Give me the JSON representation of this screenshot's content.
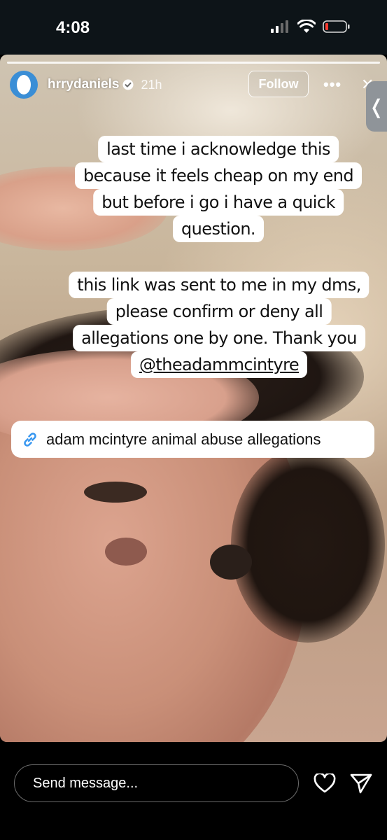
{
  "status_bar": {
    "time": "4:08"
  },
  "story": {
    "username": "hrrydaniels",
    "time_ago": "21h",
    "follow_label": "Follow",
    "more_label": "•••",
    "close_label": "✕",
    "side_handle_label": "❬",
    "caption_block_1": [
      "last time i acknowledge this",
      "because it feels cheap on my end",
      "but before i go i have a quick",
      "question."
    ],
    "caption_block_2": [
      "this link was sent to me in my dms,",
      "please confirm or deny all",
      "allegations one by one. Thank you"
    ],
    "mention": "@theadammcintyre",
    "link_sticker": {
      "icon": "link-icon",
      "text": "adam mcintyre animal abuse allegations",
      "icon_color": "#3897f0"
    }
  },
  "bottom_bar": {
    "message_placeholder": "Send message...",
    "heart_icon": "heart-icon",
    "send_icon": "send-icon"
  },
  "colors": {
    "avatar": "#3a8ed6",
    "background": "#000000",
    "status_bar": "#0d1418"
  }
}
